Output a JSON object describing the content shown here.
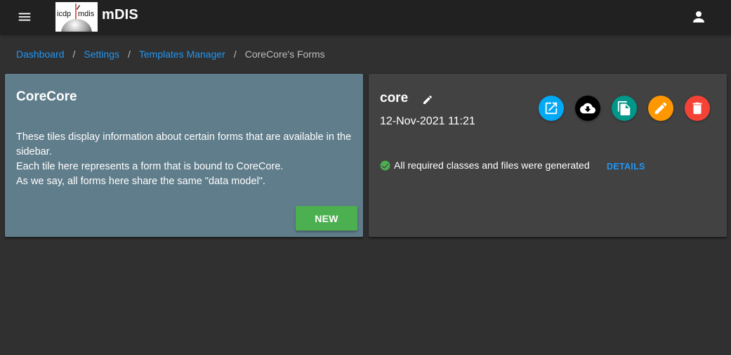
{
  "header": {
    "menu_icon": "menu-icon",
    "logo_left_text": "icdp",
    "logo_right_text": "mdis",
    "app_title": "mDIS",
    "account_icon": "account-icon"
  },
  "breadcrumb": {
    "items": [
      {
        "label": "Dashboard",
        "link": true
      },
      {
        "label": "Settings",
        "link": true
      },
      {
        "label": "Templates Manager",
        "link": true
      },
      {
        "label": "CoreCore's Forms",
        "link": false
      }
    ],
    "separator": "/"
  },
  "info_card": {
    "title": "CoreCore",
    "lines": [
      "These tiles display information about certain forms that are available in the sidebar.",
      "Each tile here represents a form that is bound to CoreCore.",
      "As we say, all forms here share the same \"data model\"."
    ],
    "new_button": "NEW",
    "background_color": "#607d8b",
    "button_color": "#4caf50"
  },
  "form_card": {
    "name": "core",
    "date": "12-Nov-2021 11:21",
    "rename_icon": "pencil-icon",
    "actions": [
      {
        "name": "open",
        "icon": "open-in-new-icon",
        "color": "#03a9f4"
      },
      {
        "name": "download",
        "icon": "cloud-download-icon",
        "color": "#000000"
      },
      {
        "name": "duplicate",
        "icon": "copy-icon",
        "color": "#009688"
      },
      {
        "name": "edit",
        "icon": "pencil-icon",
        "color": "#ff9800"
      },
      {
        "name": "delete",
        "icon": "trash-icon",
        "color": "#f44336"
      }
    ],
    "status_text": "All required classes and files were generated",
    "status_icon": "check-circle-icon",
    "status_color": "#4caf50",
    "details_button": "DETAILS"
  }
}
